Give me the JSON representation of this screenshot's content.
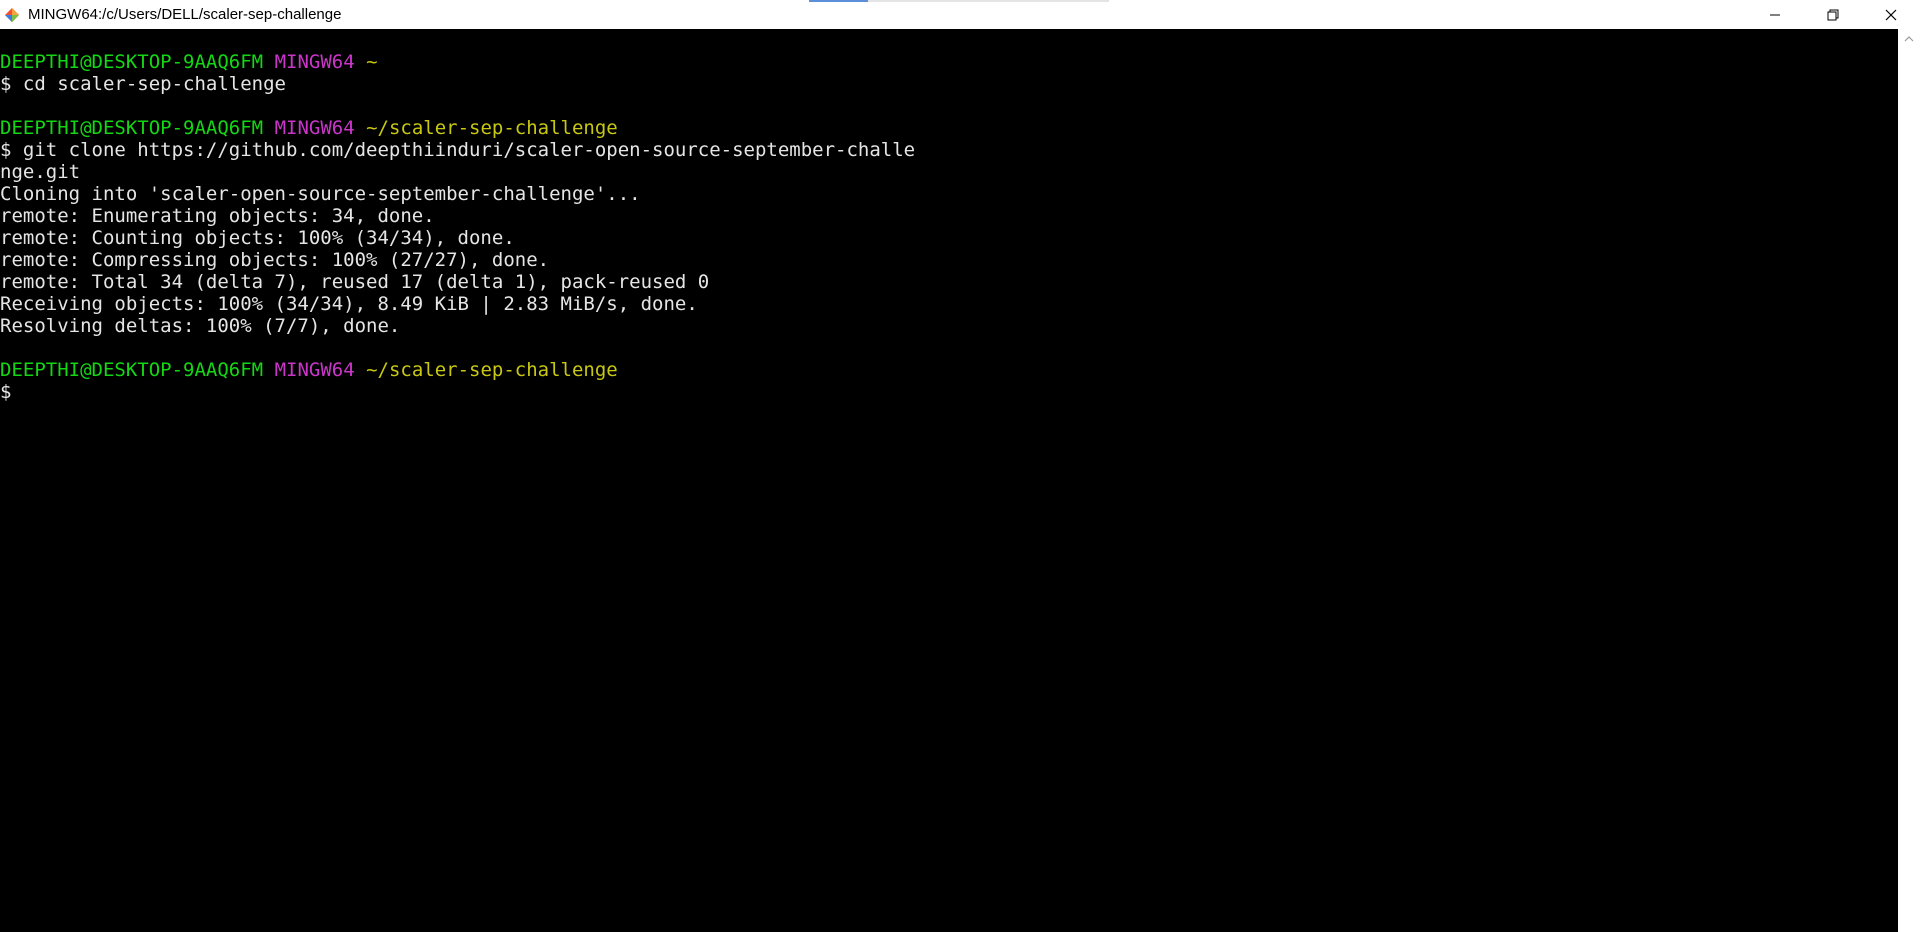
{
  "window": {
    "title": "MINGW64:/c/Users/DELL/scaler-sep-challenge",
    "icon": "git-bash-icon",
    "controls": {
      "minimize": "minimize-icon",
      "restore": "restore-icon",
      "close": "close-icon"
    }
  },
  "colors": {
    "user_host": "#14d714",
    "shell": "#c936c9",
    "path": "#c8c812",
    "text": "#e5e5e5",
    "background": "#000000"
  },
  "terminal": {
    "blocks": [
      {
        "prompt": {
          "user_host": "DEEPTHI@DESKTOP-9AAQ6FM",
          "shell": "MINGW64",
          "path": "~"
        },
        "command_lines": [
          "$ cd scaler-sep-challenge"
        ],
        "output": []
      },
      {
        "prompt": {
          "user_host": "DEEPTHI@DESKTOP-9AAQ6FM",
          "shell": "MINGW64",
          "path": "~/scaler-sep-challenge"
        },
        "command_lines": [
          "$ git clone https://github.com/deepthiinduri/scaler-open-source-september-challe",
          "nge.git"
        ],
        "output": [
          "Cloning into 'scaler-open-source-september-challenge'...",
          "remote: Enumerating objects: 34, done.",
          "remote: Counting objects: 100% (34/34), done.",
          "remote: Compressing objects: 100% (27/27), done.",
          "remote: Total 34 (delta 7), reused 17 (delta 1), pack-reused 0",
          "Receiving objects: 100% (34/34), 8.49 KiB | 2.83 MiB/s, done.",
          "Resolving deltas: 100% (7/7), done."
        ]
      },
      {
        "prompt": {
          "user_host": "DEEPTHI@DESKTOP-9AAQ6FM",
          "shell": "MINGW64",
          "path": "~/scaler-sep-challenge"
        },
        "command_lines": [
          "$"
        ],
        "output": []
      }
    ]
  }
}
